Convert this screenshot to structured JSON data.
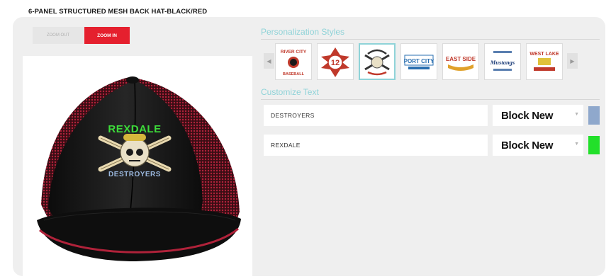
{
  "product": {
    "title": "6-PANEL STRUCTURED MESH BACK HAT-BLACK/RED"
  },
  "zoom": {
    "out_label": "ZOOM OUT",
    "in_label": "ZOOM IN"
  },
  "logo": {
    "top_text": "REXDALE",
    "bottom_text": "DESTROYERS"
  },
  "styles_section": {
    "title": "Personalization Styles",
    "tiles": [
      {
        "name": "river-city-baseball",
        "text": "RIVER CITY",
        "sub": "BASEBALL"
      },
      {
        "name": "firefighter-badge",
        "text": "12"
      },
      {
        "name": "skull-bats",
        "text": ""
      },
      {
        "name": "port-city",
        "text": "PORT CITY"
      },
      {
        "name": "east-side",
        "text": "EAST SIDE"
      },
      {
        "name": "mustangs",
        "text": "Mustangs"
      },
      {
        "name": "west-lake",
        "text": "WEST LAKE"
      }
    ]
  },
  "customize_section": {
    "title": "Customize Text",
    "rows": [
      {
        "text": "DESTROYERS",
        "font": "Block New",
        "color": "#8fa8cc"
      },
      {
        "text": "REXDALE",
        "font": "Block New",
        "color": "#22e02a"
      }
    ]
  },
  "colors": {
    "accent_red": "#e5202e",
    "section_teal": "#8fd3d8"
  }
}
